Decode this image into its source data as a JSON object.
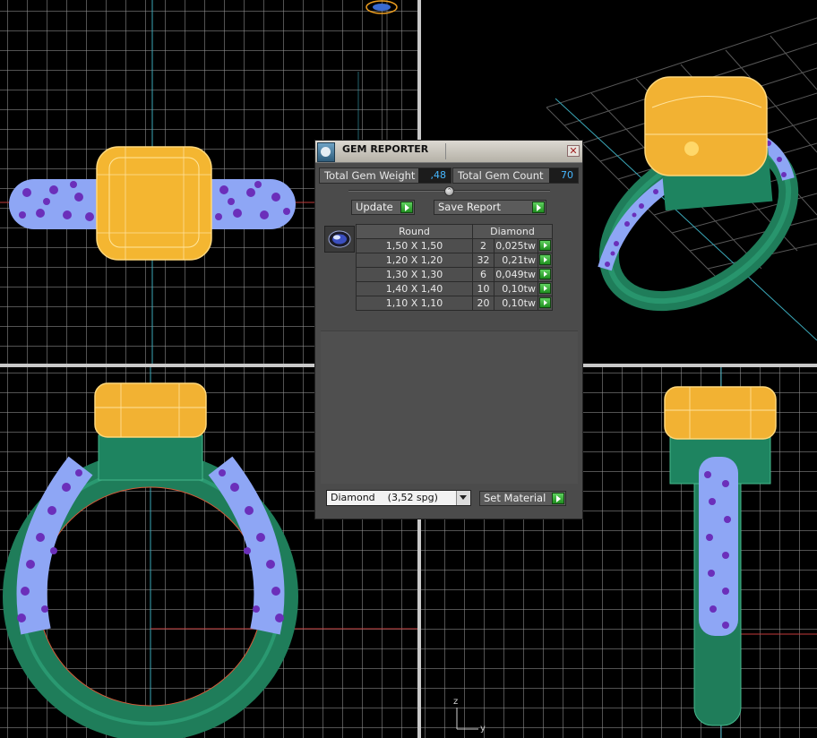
{
  "panel": {
    "title": "GEM REPORTER",
    "total_weight_label": "Total Gem Weight",
    "total_weight_value": ",48",
    "total_count_label": "Total Gem Count",
    "total_count_value": "70",
    "update_label": "Update",
    "save_report_label": "Save Report",
    "table": {
      "header_shape": "Round",
      "header_material": "Diamond",
      "rows": [
        {
          "size": "1,50 X 1,50",
          "qty": "2",
          "weight": "0,025tw"
        },
        {
          "size": "1,20 X 1,20",
          "qty": "32",
          "weight": "0,21tw"
        },
        {
          "size": "1,30 X 1,30",
          "qty": "6",
          "weight": "0,049tw"
        },
        {
          "size": "1,40 X 1,40",
          "qty": "10",
          "weight": "0,10tw"
        },
        {
          "size": "1,10 X 1,10",
          "qty": "20",
          "weight": "0,10tw"
        }
      ]
    },
    "material_select": "Diamond    (3,52 spg)",
    "set_material_label": "Set Material"
  },
  "axis": {
    "z": "z",
    "y": "y"
  },
  "colors": {
    "metal": "#2e8f6c",
    "center_stone": "#f2b233",
    "pave_stones": "#9fb2ff",
    "prongs": "#6a2fb8",
    "grid": "#7a7a7a",
    "accent_go": "#3cb83c"
  }
}
